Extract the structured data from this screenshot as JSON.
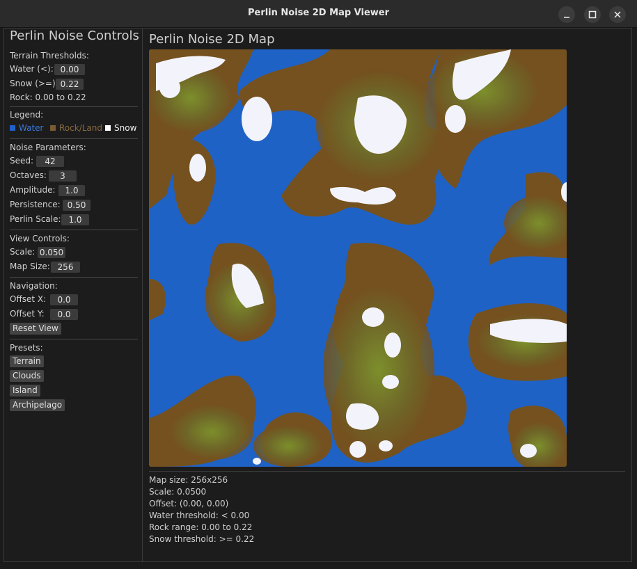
{
  "window": {
    "title": "Perlin Noise 2D Map Viewer"
  },
  "sidebar": {
    "heading": "Perlin Noise Controls",
    "thresholds": {
      "title": "Terrain Thresholds:",
      "water_label": "Water (<):",
      "water_value": "0.00",
      "snow_label": "Snow (>=):",
      "snow_value": "0.22",
      "rock_text": "Rock: 0.00 to 0.22"
    },
    "legend": {
      "title": "Legend:",
      "water": "Water",
      "rock": "Rock/Land",
      "snow": "Snow",
      "water_color": "#2060c8",
      "rock_color": "#7a5a32",
      "snow_color": "#ffffff"
    },
    "noise": {
      "title": "Noise Parameters:",
      "seed_label": "Seed:",
      "seed_value": "42",
      "octaves_label": "Octaves:",
      "octaves_value": "3",
      "amplitude_label": "Amplitude:",
      "amplitude_value": "1.0",
      "persistence_label": "Persistence:",
      "persistence_value": "0.50",
      "perlin_scale_label": "Perlin Scale:",
      "perlin_scale_value": "1.0"
    },
    "view": {
      "title": "View Controls:",
      "scale_label": "Scale:",
      "scale_value": "0.050",
      "map_size_label": "Map Size:",
      "map_size_value": "256"
    },
    "navigation": {
      "title": "Navigation:",
      "offset_x_label": "Offset X:",
      "offset_x_value": "0.0",
      "offset_y_label": "Offset Y:",
      "offset_y_value": "0.0",
      "reset_label": "Reset View"
    },
    "presets": {
      "title": "Presets:",
      "items": [
        "Terrain",
        "Clouds",
        "Island",
        "Archipelago"
      ]
    }
  },
  "main": {
    "title": "Perlin Noise 2D Map",
    "info": [
      "Map size: 256x256",
      "Scale: 0.0500",
      "Offset: (0.00, 0.00)",
      "Water threshold: < 0.00",
      "Rock range: 0.00 to 0.22",
      "Snow threshold: >= 0.22"
    ]
  }
}
